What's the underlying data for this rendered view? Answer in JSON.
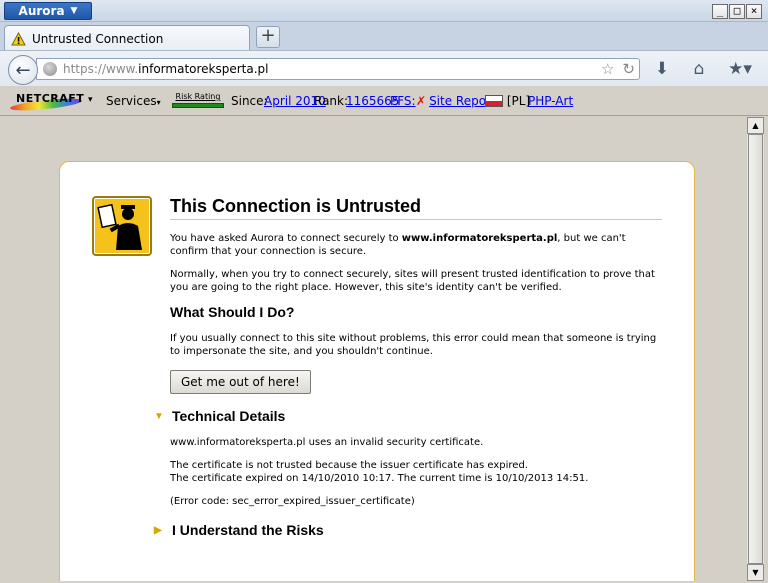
{
  "app": {
    "name": "Aurora"
  },
  "window_controls": {
    "minimize": "_",
    "maximize": "□",
    "close": "×"
  },
  "tab": {
    "title": "Untrusted Connection",
    "new_tab": "+"
  },
  "urlbar": {
    "scheme": "https://www.",
    "host": "informatoreksperta.pl"
  },
  "netcraft": {
    "logo": "NETCRAFT",
    "services": "Services",
    "risk_rating": "Risk Rating",
    "since_label": "Since:",
    "since_value": "April 2010",
    "rank_label": "Rank:",
    "rank_value": "1165665",
    "pfs": "PFS:",
    "site_report": "Site Report",
    "country": "[PL]",
    "host_org": "PHP-Art"
  },
  "error_page": {
    "title": "This Connection is Untrusted",
    "intro_pre": "You have asked Aurora to connect securely to ",
    "intro_host": "www.informatoreksperta.pl",
    "intro_post": ", but we can't confirm that your connection is secure.",
    "normally": "Normally, when you try to connect securely, sites will present trusted identification to prove that you are going to the right place. However, this site's identity can't be verified.",
    "what_heading": "What Should I Do?",
    "what_text": "If you usually connect to this site without problems, this error could mean that someone is trying to impersonate the site, and you shouldn't continue.",
    "escape_button": "Get me out of here!",
    "technical_heading": "Technical Details",
    "tech_line1": "www.informatoreksperta.pl uses an invalid security certificate.",
    "tech_line2": "The certificate is not trusted because the issuer certificate has expired.",
    "tech_line3": "The certificate expired on 14/10/2010 10:17. The current time is 10/10/2013 14:51.",
    "tech_line4": "(Error code: sec_error_expired_issuer_certificate)",
    "risks_heading": "I Understand the Risks"
  }
}
